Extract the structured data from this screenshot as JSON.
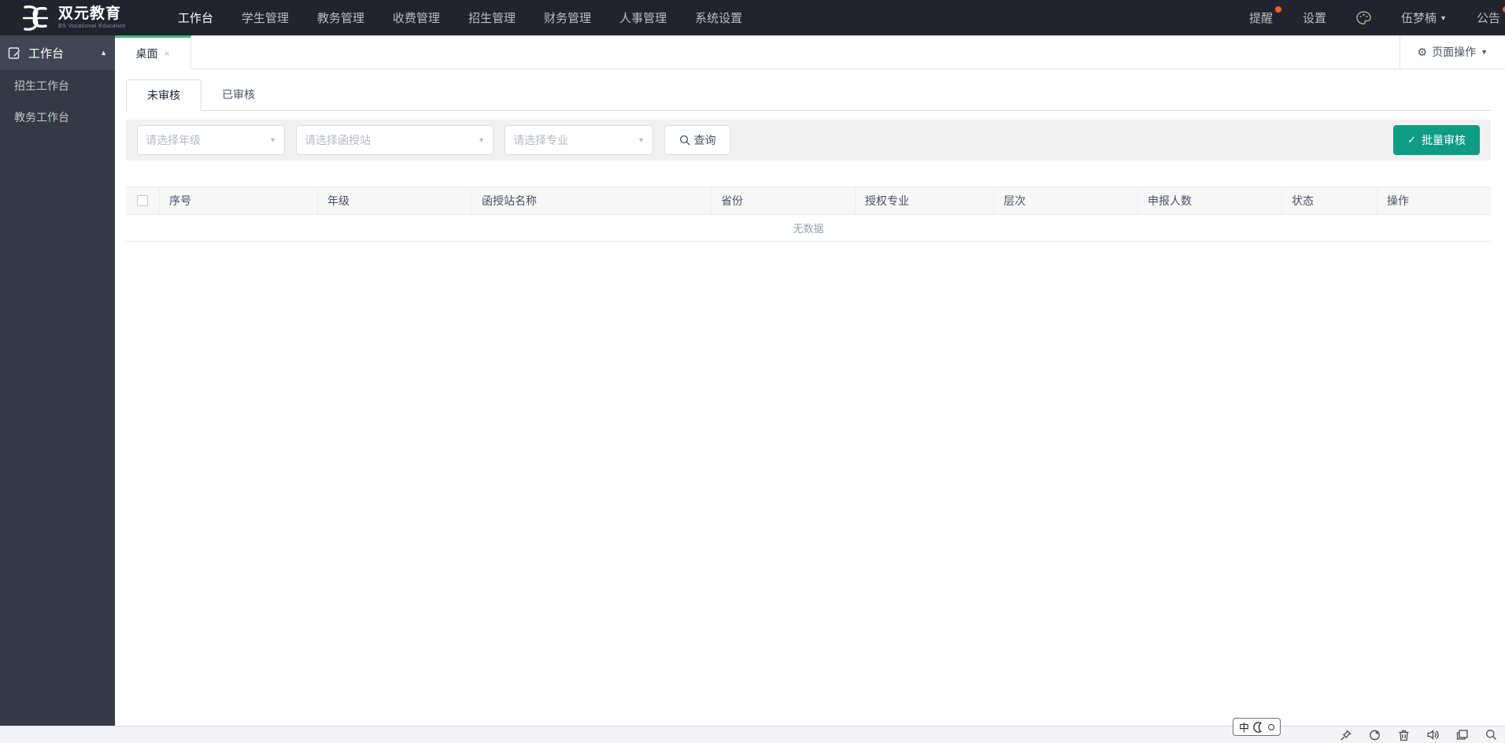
{
  "navbar": {
    "brand": {
      "title": "双元教育",
      "subtitle": "BS Vocational Education"
    },
    "menu": [
      "工作台",
      "学生管理",
      "教务管理",
      "收费管理",
      "招生管理",
      "财务管理",
      "人事管理",
      "系统设置"
    ],
    "active_menu": "工作台",
    "reminder_label": "提醒",
    "settings_label": "设置",
    "username": "伍梦楠",
    "announcement_label": "公告"
  },
  "sidebar": {
    "group_label": "工作台",
    "items": [
      {
        "label": "招生工作台"
      },
      {
        "label": "教务工作台"
      }
    ]
  },
  "tabstrip": {
    "tabs": [
      {
        "label": "桌面"
      }
    ],
    "page_actions_label": "页面操作"
  },
  "content": {
    "tabs": [
      {
        "label": "未审核",
        "active": true
      },
      {
        "label": "已审核",
        "active": false
      }
    ],
    "filters": {
      "selects": [
        {
          "placeholder": "请选择年级"
        },
        {
          "placeholder": "请选择函授站"
        },
        {
          "placeholder": "请选择专业"
        }
      ],
      "query_label": "查询",
      "batch_review_label": "批量审核"
    },
    "table": {
      "columns": [
        "序号",
        "年级",
        "函授站名称",
        "省份",
        "授权专业",
        "层次",
        "申报人数",
        "状态",
        "操作"
      ],
      "rows": [],
      "empty_text": "无数据"
    }
  },
  "statusbar": {
    "ime_lang": "中"
  },
  "icons": {
    "gear": "⚙",
    "caret_down": "▼",
    "caret_up": "▲",
    "close": "×",
    "check": "✓"
  },
  "colors": {
    "navbar_bg": "#21242d",
    "sidebar_bg": "#343945",
    "tab_accent_green": "#3eb879",
    "button_teal": "#0e9d84",
    "badge_orange": "#ff5a1e",
    "filter_bg": "#f1f1f1",
    "header_bg": "#f7f7f8"
  }
}
